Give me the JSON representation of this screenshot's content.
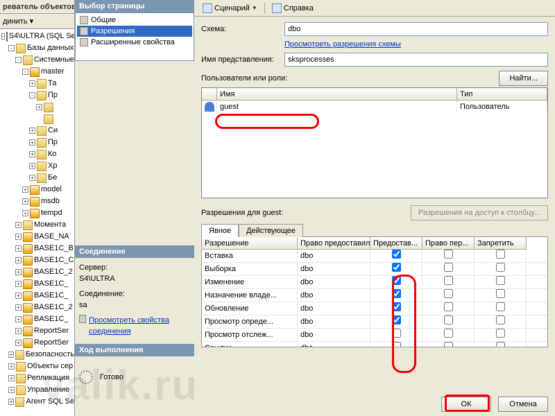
{
  "explorer": {
    "title": "реватель объектов",
    "toolbar": "динить ▾",
    "nodes": [
      {
        "ind": 1,
        "exp": "-",
        "ico": "server",
        "label": "S4\\ULTRA (SQL Se"
      },
      {
        "ind": 2,
        "exp": "-",
        "ico": "folder",
        "label": "Базы данных"
      },
      {
        "ind": 3,
        "exp": "-",
        "ico": "folder",
        "label": "Системные"
      },
      {
        "ind": 4,
        "exp": "-",
        "ico": "db",
        "label": "master"
      },
      {
        "ind": 5,
        "exp": "+",
        "ico": "folder",
        "label": "Та"
      },
      {
        "ind": 5,
        "exp": "-",
        "ico": "folder",
        "label": "Пр"
      },
      {
        "ind": 6,
        "exp": "+",
        "ico": "folder",
        "label": ""
      },
      {
        "ind": 6,
        "exp": " ",
        "ico": "folder",
        "label": ""
      },
      {
        "ind": 5,
        "exp": "+",
        "ico": "folder",
        "label": "Си"
      },
      {
        "ind": 5,
        "exp": "+",
        "ico": "folder",
        "label": "Пр"
      },
      {
        "ind": 5,
        "exp": "+",
        "ico": "folder",
        "label": "Ко"
      },
      {
        "ind": 5,
        "exp": "+",
        "ico": "folder",
        "label": "Хр"
      },
      {
        "ind": 5,
        "exp": "+",
        "ico": "folder",
        "label": "Бе"
      },
      {
        "ind": 4,
        "exp": "+",
        "ico": "db",
        "label": "model"
      },
      {
        "ind": 4,
        "exp": "+",
        "ico": "db",
        "label": "msdb"
      },
      {
        "ind": 4,
        "exp": "+",
        "ico": "db",
        "label": "tempd"
      },
      {
        "ind": 3,
        "exp": "+",
        "ico": "folder",
        "label": "Момента"
      },
      {
        "ind": 3,
        "exp": "+",
        "ico": "db",
        "label": "BASE_NA"
      },
      {
        "ind": 3,
        "exp": "+",
        "ico": "db",
        "label": "BASE1C_B"
      },
      {
        "ind": 3,
        "exp": "+",
        "ico": "db",
        "label": "BASE1C_C"
      },
      {
        "ind": 3,
        "exp": "+",
        "ico": "db",
        "label": "BASE1C_2"
      },
      {
        "ind": 3,
        "exp": "+",
        "ico": "db",
        "label": "BASE1C_"
      },
      {
        "ind": 3,
        "exp": "+",
        "ico": "db",
        "label": "BASE1C_"
      },
      {
        "ind": 3,
        "exp": "+",
        "ico": "db",
        "label": "BASE1C_2"
      },
      {
        "ind": 3,
        "exp": "+",
        "ico": "db",
        "label": "BASE1C_"
      },
      {
        "ind": 3,
        "exp": "+",
        "ico": "db",
        "label": "ReportSer"
      },
      {
        "ind": 3,
        "exp": "+",
        "ico": "db",
        "label": "ReportSer"
      },
      {
        "ind": 2,
        "exp": "+",
        "ico": "folder",
        "label": "Безопасность"
      },
      {
        "ind": 2,
        "exp": "+",
        "ico": "folder",
        "label": "Объекты сер"
      },
      {
        "ind": 2,
        "exp": "+",
        "ico": "folder",
        "label": "Репликация"
      },
      {
        "ind": 2,
        "exp": "+",
        "ico": "folder",
        "label": "Управление"
      },
      {
        "ind": 2,
        "exp": "+",
        "ico": "folder",
        "label": "Агент SQL Se"
      }
    ]
  },
  "page_selector": {
    "title": "Выбор страницы",
    "items": [
      "Общие",
      "Разрешения",
      "Расширенные свойства"
    ],
    "selected": 1
  },
  "connection": {
    "title": "Соединение",
    "server_label": "Сервер:",
    "server_value": "S4\\ULTRA",
    "conn_label": "Соединение:",
    "conn_value": "sa",
    "view_link": "Просмотреть свойства соединения"
  },
  "progress": {
    "title": "Ход выполнения",
    "status": "Готово"
  },
  "main": {
    "toolbar": {
      "script": "Сценарий",
      "help": "Справка"
    },
    "schema_label": "Схема:",
    "schema_value": "dbo",
    "view_schema_link": "Просмотреть разрешения схемы",
    "view_name_label": "Имя представления:",
    "view_name_value": "sksprocesses",
    "users_label": "Пользователи или роли:",
    "find_btn": "Найти...",
    "users_cols": {
      "name": "Имя",
      "type": "Тип"
    },
    "users_rows": [
      {
        "name": "guest",
        "type": "Пользователь"
      }
    ],
    "perm_label": "Разрешения для guest:",
    "col_access_btn": "Разрешения на доступ к столбцу...",
    "tabs": {
      "explicit": "Явное",
      "effective": "Действующее"
    },
    "perm_cols": {
      "perm": "Разрешение",
      "grantor": "Право предоставил",
      "grant": "Предостав...",
      "withgrant": "Право пер...",
      "deny": "Запретить"
    },
    "perm_rows": [
      {
        "perm": "Вставка",
        "grantor": "dbo",
        "grant": true,
        "wg": false,
        "deny": false
      },
      {
        "perm": "Выборка",
        "grantor": "dbo",
        "grant": true,
        "wg": false,
        "deny": false
      },
      {
        "perm": "Изменение",
        "grantor": "dbo",
        "grant": true,
        "wg": false,
        "deny": false
      },
      {
        "perm": "Назначение владе...",
        "grantor": "dbo",
        "grant": true,
        "wg": false,
        "deny": false
      },
      {
        "perm": "Обновление",
        "grantor": "dbo",
        "grant": true,
        "wg": false,
        "deny": false
      },
      {
        "perm": "Просмотр опреде...",
        "grantor": "dbo",
        "grant": true,
        "wg": false,
        "deny": false
      },
      {
        "perm": "Просмотр отслеж...",
        "grantor": "dbo",
        "grant": false,
        "wg": false,
        "deny": false
      },
      {
        "perm": "Ссылки",
        "grantor": "dbo",
        "grant": false,
        "wg": false,
        "deny": false
      }
    ],
    "buttons": {
      "ok": "ОК",
      "cancel": "Отмена"
    }
  },
  "watermark": "valik.ru"
}
